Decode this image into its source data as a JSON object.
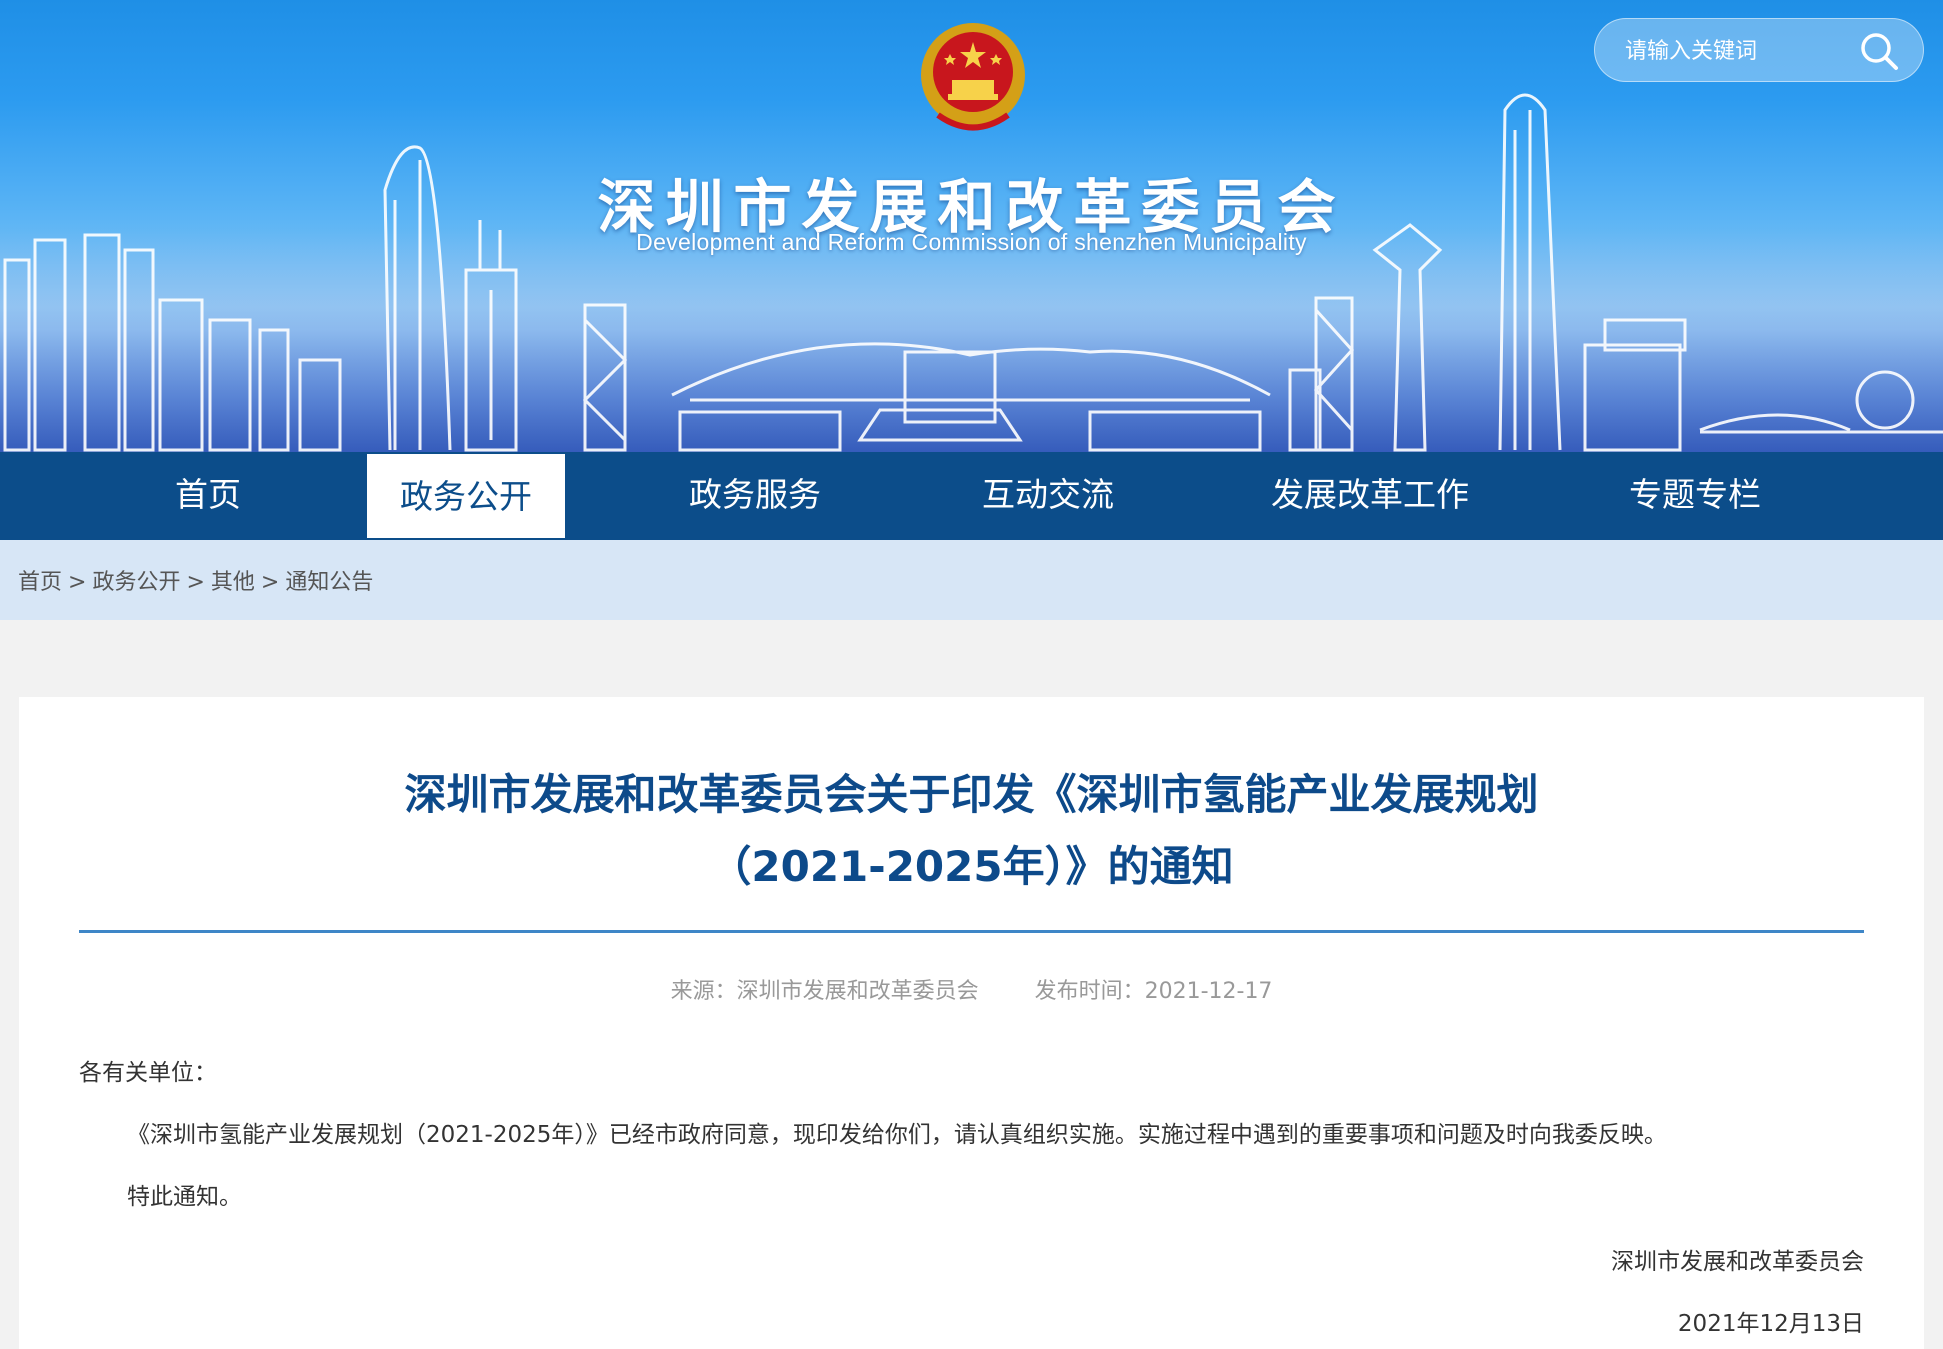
{
  "header": {
    "title": "深圳市发展和改革委员会",
    "subtitle": "Development and Reform Commission of shenzhen Municipality",
    "emblem_icon": "national-emblem-icon",
    "search": {
      "placeholder": "请输入关键词",
      "icon": "search-icon"
    }
  },
  "nav": {
    "items": [
      {
        "label": "首页",
        "active": false
      },
      {
        "label": "政务公开",
        "active": true
      },
      {
        "label": "政务服务",
        "active": false
      },
      {
        "label": "互动交流",
        "active": false
      },
      {
        "label": "发展改革工作",
        "active": false
      },
      {
        "label": "专题专栏",
        "active": false
      }
    ]
  },
  "breadcrumb": {
    "items": [
      "首页",
      "政务公开",
      "其他",
      "通知公告"
    ],
    "separator": ">"
  },
  "article": {
    "title_line1": "深圳市发展和改革委员会关于印发《深圳市氢能产业发展规划",
    "title_line2": "（2021-2025年）》的通知",
    "source_label": "来源：深圳市发展和改革委员会",
    "publish_label": "发布时间：2021-12-17",
    "salutation": "各有关单位：",
    "paragraph": "《深圳市氢能产业发展规划（2021-2025年）》已经市政府同意，现印发给你们，请认真组织实施。实施过程中遇到的重要事项和问题及时向我委反映。",
    "closing": "特此通知。",
    "signature": "深圳市发展和改革委员会",
    "date": "2021年12月13日"
  },
  "colors": {
    "nav_bg": "#0c4d8a",
    "breadcrumb_bg": "#d7e6f6",
    "title_color": "#0d4a8a",
    "rule_color": "#3e86c7",
    "page_bg": "#f2f2f2"
  }
}
